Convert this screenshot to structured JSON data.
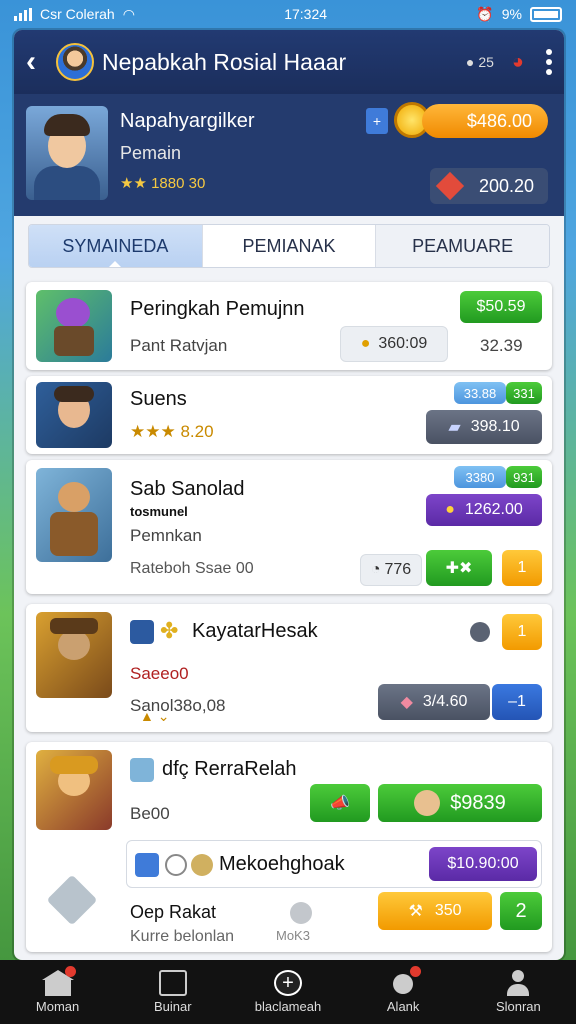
{
  "status": {
    "carrier": "Csr Colerah",
    "time": "17:324",
    "battery": "9%"
  },
  "header": {
    "title": "Nepabkah Rosial Haaar",
    "icon_text": "25"
  },
  "profile": {
    "name": "Napahyargilker",
    "role": "Pemain",
    "rating": "1880 30",
    "coins": "$486.00",
    "gems": "200.20"
  },
  "tabs": [
    {
      "label": "SYMAINEDA"
    },
    {
      "label": "PEMIANAK"
    },
    {
      "label": "PEAMUARE"
    }
  ],
  "cards": [
    {
      "name": "Peringkah Pemujnn",
      "sub": "Pant Ratvjan",
      "price": "$50.59",
      "coin_value": "360:09",
      "side_value": "32.39"
    },
    {
      "name": "Suens",
      "rating": "8.20",
      "badge_a": "33.88",
      "badge_b": "331",
      "value": "398.10"
    },
    {
      "name": "Sab Sanolad",
      "sub_bold": "tosmunel",
      "sub": "Pemnkan",
      "footer": "Rateboh Ssae 00",
      "badge_a": "3380",
      "badge_b": "931",
      "value": "1262.00",
      "timer": "776",
      "count": "1"
    },
    {
      "name": "KayatarHesak",
      "sub_red": "Saeeo0",
      "sub": "Sanol38o,08",
      "count": "1",
      "value": "3/4.60",
      "minus": "–1"
    },
    {
      "name": "dfç RerraRelah",
      "sub": "Be00",
      "value": "$9839",
      "inner_name": "Mekoehghoak",
      "inner_value": "$10.90:00",
      "footer_name": "Oep Rakat",
      "footer_sub": "Kurre belonlan",
      "footer_hint": "MoK3",
      "orange_value": "350",
      "green_count": "2"
    }
  ],
  "nav": [
    {
      "label": "Moman"
    },
    {
      "label": "Buinar"
    },
    {
      "label": "blaclameah"
    },
    {
      "label": "Alank"
    },
    {
      "label": "Slonran"
    }
  ]
}
